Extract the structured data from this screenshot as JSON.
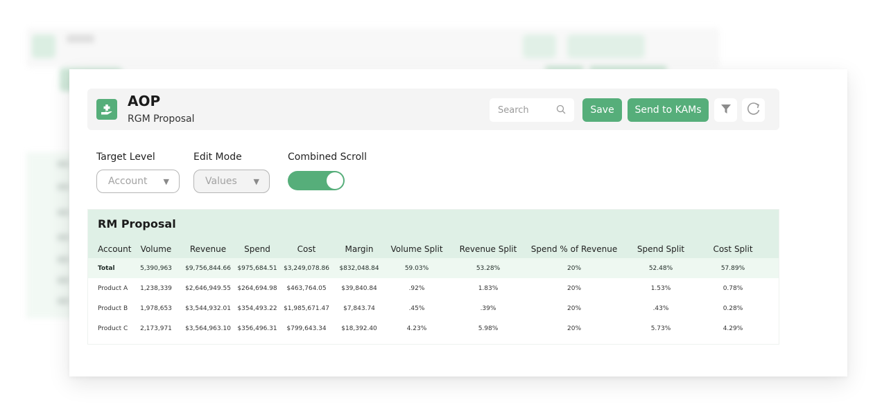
{
  "app": {
    "title": "AOP",
    "subtitle": "RGM Proposal",
    "brand_color": "#56ae7a",
    "icon": "hand-plus-icon"
  },
  "toolbar": {
    "search_placeholder": "Search",
    "search_value": "",
    "save_label": "Save",
    "send_label": "Send to KAMs",
    "filter_icon": "filter-icon",
    "refresh_icon": "refresh-icon"
  },
  "controls": {
    "target_level": {
      "label": "Target Level",
      "value": "Account"
    },
    "edit_mode": {
      "label": "Edit Mode",
      "value": "Values"
    },
    "combined_scroll": {
      "label": "Combined Scroll",
      "on": true
    }
  },
  "table": {
    "title": "RM Proposal",
    "columns": [
      "Account",
      "Volume",
      "Revenue",
      "Spend",
      "Cost",
      "Margin",
      "Volume Split",
      "Revenue Split",
      "Spend % of Revenue",
      "Spend Split",
      "Cost Split"
    ],
    "rows": [
      [
        "Total",
        "5,390,963",
        "$9,756,844.66",
        "$975,684.51",
        "$3,249,078.86",
        "$832,048.84",
        "59.03%",
        "53.28%",
        "20%",
        "52.48%",
        "57.89%"
      ],
      [
        "Product A",
        "1,238,339",
        "$2,646,949.55",
        "$264,694.98",
        "$463,764.05",
        "$39,840.84",
        ".92%",
        "1.83%",
        "20%",
        "1.53%",
        "0.78%"
      ],
      [
        "Product B",
        "1,978,653",
        "$3,544,932.01",
        "$354,493.22",
        "$1,985,671.47",
        "$7,843.74",
        ".45%",
        ".39%",
        "20%",
        ".43%",
        "0.28%"
      ],
      [
        "Product C",
        "2,173,971",
        "$3,564,963.10",
        "$356,496.31",
        "$799,643.34",
        "$18,392.40",
        "4.23%",
        "5.98%",
        "20%",
        "5.73%",
        "4.29%"
      ]
    ]
  }
}
